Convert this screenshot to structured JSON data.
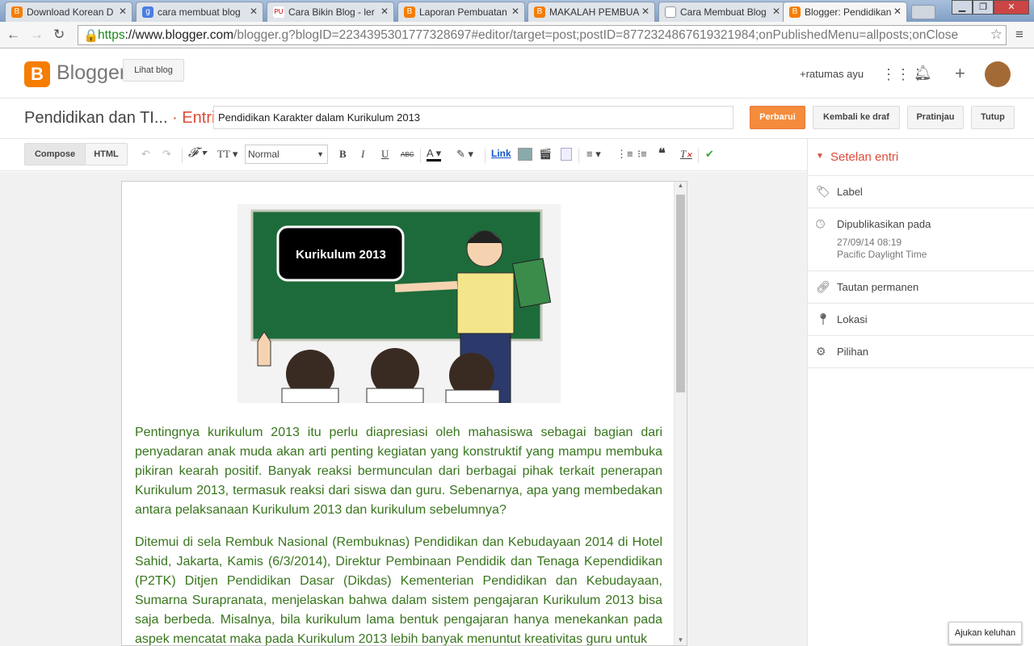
{
  "browser": {
    "tabs": [
      {
        "title": "Download Korean D",
        "icon": "blogger-icon"
      },
      {
        "title": "cara membuat blog",
        "icon": "google-icon"
      },
      {
        "title": "Cara Bikin Blog - ler",
        "icon": "pu-icon"
      },
      {
        "title": "Laporan Pembuatan",
        "icon": "blogger-icon"
      },
      {
        "title": "MAKALAH PEMBUA",
        "icon": "blogger-icon"
      },
      {
        "title": "Cara Membuat Blog",
        "icon": "page-icon"
      },
      {
        "title": "Blogger: Pendidikan",
        "icon": "blogger-icon",
        "active": true
      }
    ],
    "url_scheme": "https",
    "url_host": "://www.blogger.com",
    "url_path": "/blogger.g?blogID=2234395301777328697#editor/target=post;postID=8772324867619321984;onPublishedMenu=allposts;onClose"
  },
  "header": {
    "logo_text": "Blogger",
    "view_blog": "Lihat blog",
    "user": "+ratumas ayu"
  },
  "titlebar": {
    "blog_name": "Pendidikan dan TI...",
    "section": "· Entri",
    "post_title": "Pendidikan Karakter dalam Kurikulum 2013",
    "update": "Perbarui",
    "revert": "Kembali ke draf",
    "preview": "Pratinjau",
    "close": "Tutup"
  },
  "toolbar": {
    "compose": "Compose",
    "html": "HTML",
    "format": "Normal",
    "link": "Link"
  },
  "post": {
    "image_caption": "Kurikulum 2013",
    "paragraphs": [
      "Pentingnya kurikulum 2013 itu perlu diapresiasi oleh mahasiswa sebagai bagian dari penyadaran anak muda akan arti penting kegiatan yang konstruktif yang mampu membuka pikiran kearah positif. Banyak reaksi bermunculan dari berbagai pihak terkait penerapan Kurikulum 2013, termasuk reaksi dari siswa dan guru. Sebenarnya, apa yang membedakan antara pelaksanaan Kurikulum 2013 dan kurikulum sebelumnya?",
      "Ditemui di sela Rembuk Nasional (Rembuknas) Pendidikan dan Kebudayaan 2014 di Hotel Sahid, Jakarta, Kamis (6/3/2014), Direktur Pembinaan Pendidik dan Tenaga Kependidikan (P2TK) Ditjen Pendidikan Dasar (Dikdas) Kementerian Pendidikan dan Kebudayaan, Sumarna Surapranata, menjelaskan bahwa dalam sistem pengajaran Kurikulum 2013 bisa saja berbeda. Misalnya, bila kurikulum lama bentuk pengajaran hanya menekankan pada aspek mencatat maka pada Kurikulum 2013 lebih banyak menuntut kreativitas guru untuk"
    ]
  },
  "sidebar": {
    "heading": "Setelan entri",
    "label": "Label",
    "published": "Dipublikasikan pada",
    "published_date": "27/09/14 08:19",
    "timezone": "Pacific Daylight Time",
    "permalink": "Tautan permanen",
    "location": "Lokasi",
    "options": "Pilihan"
  },
  "feedback": "Ajukan keluhan",
  "colors": {
    "accent": "#dd4b39",
    "brand": "#f57d00",
    "text_green": "#38761d"
  }
}
